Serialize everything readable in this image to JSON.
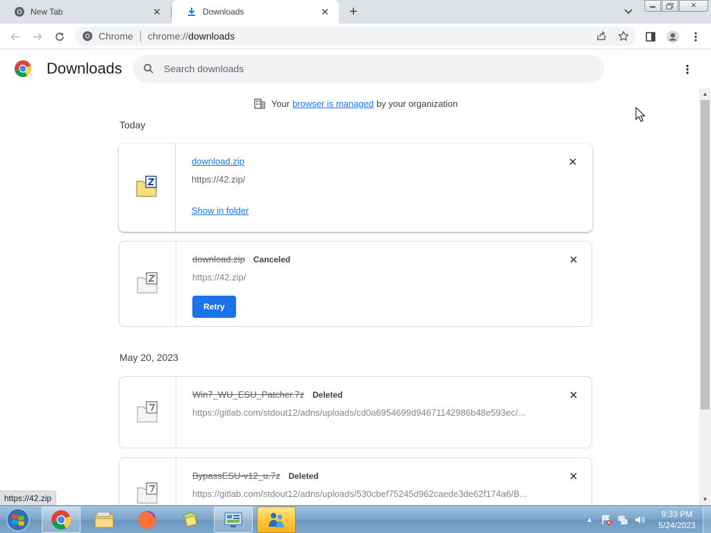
{
  "tabs": [
    {
      "label": "New Tab",
      "icon": "chrome-icon"
    },
    {
      "label": "Downloads",
      "icon": "download-icon",
      "active": true
    }
  ],
  "toolbar": {
    "omnibox_chip": "Chrome",
    "url_scheme": "chrome://",
    "url_path": "downloads"
  },
  "header": {
    "title": "Downloads",
    "search_placeholder": "Search downloads"
  },
  "managed_notice": {
    "prefix": "Your",
    "link": "browser is managed",
    "suffix": "by your organization"
  },
  "sections": [
    {
      "date": "Today",
      "items": [
        {
          "filename": "download.zip",
          "url": "https://42.zip/",
          "status": "",
          "action": "Show in folder"
        },
        {
          "filename": "download.zip",
          "url": "https://42.zip/",
          "status": "Canceled",
          "action": "Retry"
        }
      ]
    },
    {
      "date": "May 20, 2023",
      "items": [
        {
          "filename": "Win7_WU_ESU_Patcher.7z",
          "url": "https://gitlab.com/stdout12/adns/uploads/cd0a6954699d94671142986b48e593ec/...",
          "status": "Deleted"
        },
        {
          "filename": "BypassESU-v12_u.7z",
          "url": "https://gitlab.com/stdout12/adns/uploads/530cbef75245d962caede3de62f174a6/B...",
          "status": "Deleted"
        }
      ]
    }
  ],
  "status_bubble": "https://42.zip",
  "taskbar": {
    "time": "9:33 PM",
    "date": "5/24/2023"
  },
  "colors": {
    "accent": "#1a73e8",
    "tabstrip": "#dee1e6"
  }
}
